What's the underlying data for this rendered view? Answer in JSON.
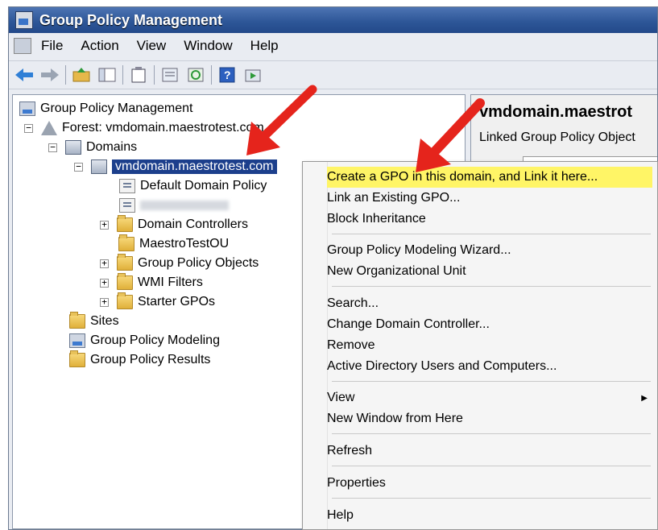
{
  "window": {
    "title": "Group Policy Management"
  },
  "menubar": {
    "items": [
      "File",
      "Action",
      "View",
      "Window",
      "Help"
    ]
  },
  "toolbar": {
    "buttons": [
      "back-arrow-icon",
      "forward-arrow-icon",
      "up-folder-icon",
      "show-hide-tree-icon",
      "clipboard-icon",
      "properties-icon",
      "refresh-icon",
      "help-icon",
      "console-icon"
    ]
  },
  "tree": {
    "root": "Group Policy Management",
    "forest": "Forest: vmdomain.maestrotest.com",
    "domains": "Domains",
    "domain": "vmdomain.maestrotest.com",
    "default_policy": "Default Domain Policy",
    "domain_controllers": "Domain Controllers",
    "ou": "MaestroTestOU",
    "gpo": "Group Policy Objects",
    "wmi": "WMI Filters",
    "starter": "Starter GPOs",
    "sites": "Sites",
    "modeling": "Group Policy Modeling",
    "results": "Group Policy Results"
  },
  "right_pane": {
    "title": "vmdomain.maestrot",
    "tab": "Linked Group Policy Object"
  },
  "context_menu": {
    "create_gpo": "Create a GPO in this domain, and Link it here...",
    "link_existing": "Link an Existing GPO...",
    "block_inheritance": "Block Inheritance",
    "modeling_wizard": "Group Policy Modeling Wizard...",
    "new_ou": "New Organizational Unit",
    "search": "Search...",
    "change_dc": "Change Domain Controller...",
    "remove": "Remove",
    "aduc": "Active Directory Users and Computers...",
    "view": "View",
    "new_window": "New Window from Here",
    "refresh": "Refresh",
    "properties": "Properties",
    "help": "Help"
  },
  "colors": {
    "highlight": "#fff566",
    "selection": "#1c3f8c",
    "annotation_arrow": "#e5241c"
  }
}
